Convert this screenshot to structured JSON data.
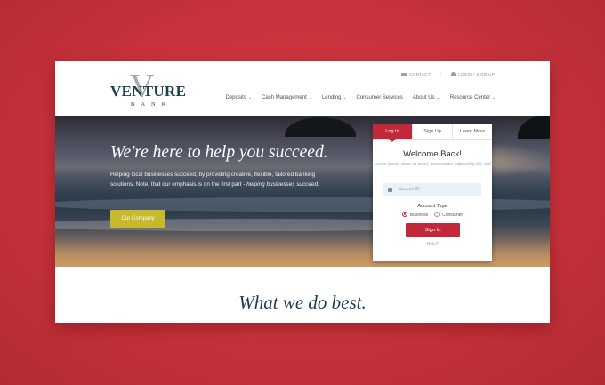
{
  "brand": {
    "logo_word": "VENTURE",
    "logo_v": "V",
    "logo_bank": "BANK"
  },
  "topbar": {
    "contact": "CONTACT",
    "login": "LOGIN / SIGN UP"
  },
  "nav": [
    {
      "label": "Deposits",
      "has_menu": true
    },
    {
      "label": "Cash Management",
      "has_menu": true
    },
    {
      "label": "Lending",
      "has_menu": true
    },
    {
      "label": "Consumer Services",
      "has_menu": false
    },
    {
      "label": "About Us",
      "has_menu": true
    },
    {
      "label": "Resource Center",
      "has_menu": true
    }
  ],
  "hero": {
    "headline": "We're here to help you succeed.",
    "subcopy_main": "Helping local businesses succeed, by providing creative, flexible, tailored banking solutions. Note, that our emphasis is on the first part - ",
    "subcopy_em": "helping businesses succeed.",
    "cta": "Our Company"
  },
  "login": {
    "tabs": [
      "Log In",
      "Sign Up",
      "Learn More"
    ],
    "title": "Welcome Back!",
    "lorem": "Lorem ipsum dolor sit amet, consectetur adipiscing elit, sed",
    "access_placeholder": "access ID",
    "account_type_label": "Account Type",
    "options": [
      "Business",
      "Consumer"
    ],
    "selected": "Business",
    "signin": "Sign In",
    "help": "Help?"
  },
  "section_title": "What we do best.",
  "colors": {
    "background": "#c8323c",
    "accent": "#c3283a",
    "cta": "#c8b82b",
    "navy": "#1f3a4d"
  }
}
